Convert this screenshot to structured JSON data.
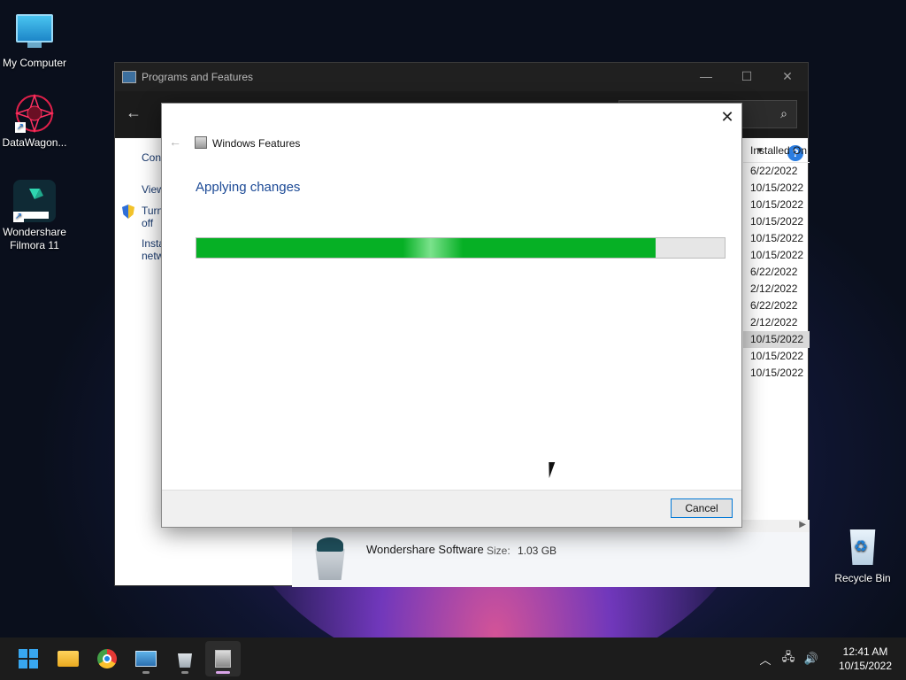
{
  "desktop": {
    "icons": [
      {
        "label": "My Computer"
      },
      {
        "label": "DataWagon..."
      },
      {
        "label": "Wondershare Filmora 11"
      },
      {
        "label": "Recycle Bin"
      }
    ]
  },
  "programs_window": {
    "title": "Programs and Features",
    "controls": {
      "minimize": "—",
      "maximize": "☐",
      "close": "✕"
    },
    "left_links": [
      "Cont",
      "View",
      "Turn off",
      "Insta netw"
    ],
    "list_header": "Installed On",
    "installed_dates": [
      "6/22/2022",
      "10/15/2022",
      "10/15/2022",
      "10/15/2022",
      "10/15/2022",
      "10/15/2022",
      "6/22/2022",
      "2/12/2022",
      "6/22/2022",
      "2/12/2022",
      "10/15/2022",
      "10/15/2022",
      "10/15/2022"
    ],
    "selected_row_index": 10,
    "details": {
      "name": "Wondershare Software",
      "size_label": "Size:",
      "size_value": "1.03 GB"
    }
  },
  "dialog": {
    "title": "Windows Features",
    "heading": "Applying changes",
    "progress_percent": 87,
    "cancel_label": "Cancel",
    "close_glyph": "✕"
  },
  "taskbar": {
    "apps": [
      "Start",
      "File Explorer",
      "Google Chrome",
      "Control Panel",
      "Package installer",
      "Windows Features"
    ],
    "clock_time": "12:41 AM",
    "clock_date": "10/15/2022"
  },
  "colors": {
    "accent": "#0078d7",
    "progress": "#06b025",
    "heading": "#1c4a96"
  }
}
